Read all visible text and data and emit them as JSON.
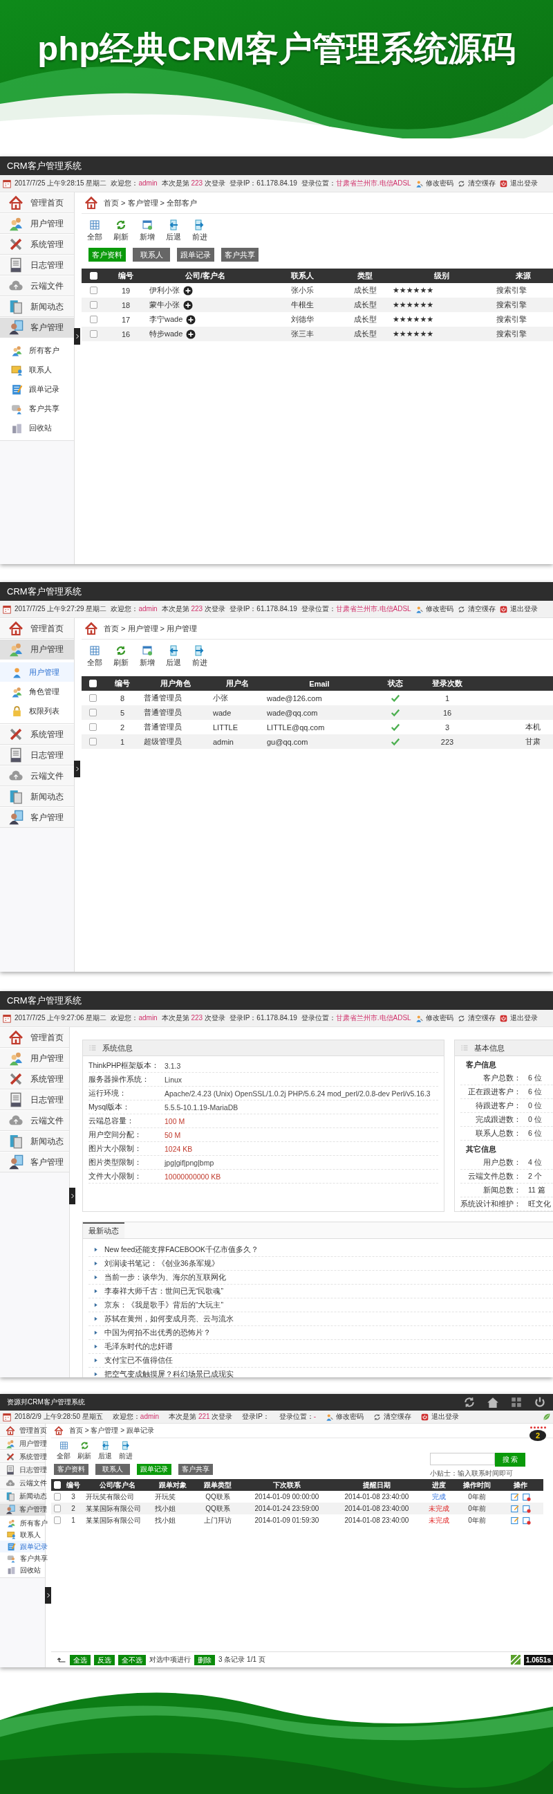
{
  "banner": {
    "title": "php经典CRM客户管理系统源码"
  },
  "screens": [
    {
      "kind": "list",
      "app_title": "CRM客户管理系统",
      "info": {
        "datetime": "2017/7/25 上午9:28:15 星期二",
        "welcome_label": "欢迎您：",
        "user": "admin",
        "login_prefix": "本次是第 ",
        "login_count": "223",
        "login_suffix": " 次登录",
        "ip": "登录IP：61.178.84.19",
        "location_label": "登录位置：",
        "location": "甘肃省兰州市.电信ADSL",
        "actions": [
          "修改密码",
          "清空缓存",
          "退出登录"
        ]
      },
      "sidebar": [
        {
          "label": "管理首页",
          "selected": false
        },
        {
          "label": "用户管理",
          "selected": false
        },
        {
          "label": "系统管理",
          "selected": false
        },
        {
          "label": "日志管理",
          "selected": false
        },
        {
          "label": "云端文件",
          "selected": false
        },
        {
          "label": "新闻动态",
          "selected": false
        },
        {
          "label": "客户管理",
          "selected": true,
          "children": [
            {
              "label": "所有客户",
              "selected": false
            },
            {
              "label": "联系人",
              "selected": false
            },
            {
              "label": "跟单记录",
              "selected": false
            },
            {
              "label": "客户共享",
              "selected": false
            },
            {
              "label": "回收站",
              "selected": false
            }
          ]
        }
      ],
      "breadcrumb": "首页 > 客户管理 > 全部客户",
      "toolbar": [
        "全部",
        "刷新",
        "新增",
        "后退",
        "前进"
      ],
      "tabs": [
        {
          "label": "客户资料",
          "selected": true
        },
        {
          "label": "联系人",
          "selected": false
        },
        {
          "label": "跟单记录",
          "selected": false
        },
        {
          "label": "客户共享",
          "selected": false
        }
      ],
      "table": {
        "select_all": {
          "checked": false
        },
        "columns": [
          {
            "kind": "text",
            "label": "编号"
          },
          {
            "kind": "name_plus",
            "label": "公司/客户名"
          },
          {
            "kind": "text",
            "label": "联系人"
          },
          {
            "kind": "text",
            "label": "类型"
          },
          {
            "kind": "text",
            "label": "级别"
          },
          {
            "kind": "text",
            "label": "来源"
          }
        ],
        "rows": [
          {
            "checked": false,
            "cells": [
              "19",
              "伊利小张",
              "张小乐",
              "成长型",
              "★★★★★★",
              "搜索引擎"
            ]
          },
          {
            "checked": false,
            "cells": [
              "18",
              "蒙牛小张",
              "牛根生",
              "成长型",
              "★★★★★★",
              "搜索引擎"
            ]
          },
          {
            "checked": false,
            "cells": [
              "17",
              "李宁wade",
              "刘德华",
              "成长型",
              "★★★★★★",
              "搜索引擎"
            ]
          },
          {
            "checked": false,
            "cells": [
              "16",
              "特步wade",
              "张三丰",
              "成长型",
              "★★★★★★",
              "搜索引擎"
            ]
          }
        ]
      }
    },
    {
      "kind": "list",
      "app_title": "CRM客户管理系统",
      "info": {
        "datetime": "2017/7/25 上午9:27:29 星期二",
        "welcome_label": "欢迎您：",
        "user": "admin",
        "login_prefix": "本次是第 ",
        "login_count": "223",
        "login_suffix": " 次登录",
        "ip": "登录IP：61.178.84.19",
        "location_label": "登录位置：",
        "location": "甘肃省兰州市.电信ADSL",
        "actions": [
          "修改密码",
          "清空缓存",
          "退出登录"
        ]
      },
      "sidebar": [
        {
          "label": "管理首页",
          "selected": false
        },
        {
          "label": "用户管理",
          "selected": true,
          "children": [
            {
              "label": "用户管理",
              "selected": true
            },
            {
              "label": "角色管理",
              "selected": false
            },
            {
              "label": "权限列表",
              "selected": false
            }
          ]
        },
        {
          "label": "系统管理",
          "selected": false
        },
        {
          "label": "日志管理",
          "selected": false
        },
        {
          "label": "云端文件",
          "selected": false
        },
        {
          "label": "新闻动态",
          "selected": false
        },
        {
          "label": "客户管理",
          "selected": false
        }
      ],
      "breadcrumb": "首页 > 用户管理 > 用户管理",
      "toolbar": [
        "全部",
        "刷新",
        "新增",
        "后退",
        "前进"
      ],
      "table": {
        "select_all": {
          "checked": false
        },
        "columns": [
          {
            "kind": "text",
            "label": "编号"
          },
          {
            "kind": "text",
            "label": "用户角色"
          },
          {
            "kind": "text",
            "label": "用户名"
          },
          {
            "kind": "text",
            "label": "Email"
          },
          {
            "kind": "status",
            "label": "状态"
          },
          {
            "kind": "text",
            "label": "登录次数"
          },
          {
            "kind": "text"
          }
        ],
        "rows": [
          {
            "checked": false,
            "cells": [
              "8",
              "普通管理员",
              "小张",
              "wade@126.com",
              true,
              "1",
              null
            ]
          },
          {
            "checked": false,
            "cells": [
              "5",
              "普通管理员",
              "wade",
              "wade@qq.com",
              true,
              "16",
              null
            ]
          },
          {
            "checked": false,
            "cells": [
              "2",
              "普通管理员",
              "LITTLE",
              "LITTLE@qq.com",
              true,
              "3",
              "本机"
            ]
          },
          {
            "checked": false,
            "cells": [
              "1",
              "超级管理员",
              "admin",
              "gu@qq.com",
              true,
              "223",
              "甘肃"
            ]
          }
        ]
      }
    },
    {
      "kind": "dashboard",
      "app_title": "CRM客户管理系统",
      "info": {
        "datetime": "2017/7/25 上午9:27:06 星期二",
        "welcome_label": "欢迎您：",
        "user": "admin",
        "login_prefix": "本次是第 ",
        "login_count": "223",
        "login_suffix": " 次登录",
        "ip": "登录IP：61.178.84.19",
        "location_label": "登录位置：",
        "location": "甘肃省兰州市.电信ADSL",
        "actions": [
          "修改密码",
          "清空缓存",
          "退出登录"
        ]
      },
      "sidebar": [
        {
          "label": "管理首页",
          "selected": false
        },
        {
          "label": "用户管理",
          "selected": false
        },
        {
          "label": "系统管理",
          "selected": false
        },
        {
          "label": "日志管理",
          "selected": false
        },
        {
          "label": "云端文件",
          "selected": false
        },
        {
          "label": "新闻动态",
          "selected": false
        },
        {
          "label": "客户管理",
          "selected": false
        }
      ],
      "system_info": {
        "title": "系统信息",
        "items": [
          {
            "label": "ThinkPHP框架版本：",
            "value": "3.1.3",
            "highlight": false
          },
          {
            "label": "服务器操作系统：",
            "value": "Linux",
            "highlight": false
          },
          {
            "label": "运行环境：",
            "value": "Apache/2.4.23 (Unix) OpenSSL/1.0.2j PHP/5.6.24 mod_perl/2.0.8-dev Perl/v5.16.3",
            "highlight": false
          },
          {
            "label": "Mysql版本：",
            "value": "5.5.5-10.1.19-MariaDB",
            "highlight": false
          },
          {
            "label": "云端总容量：",
            "value": "100 M",
            "highlight": true
          },
          {
            "label": "用户空间分配：",
            "value": "50 M",
            "highlight": true
          },
          {
            "label": "图片大小限制：",
            "value": "1024 KB",
            "highlight": true
          },
          {
            "label": "图片类型限制：",
            "value": "jpg|gif|png|bmp",
            "highlight": false
          },
          {
            "label": "文件大小限制：",
            "value": "10000000000 KB",
            "highlight": true
          }
        ]
      },
      "basic_info": {
        "title": "基本信息",
        "groups": [
          {
            "title": "客户信息",
            "items": [
              {
                "label": "客户总数：",
                "value": "6 位"
              },
              {
                "label": "正在跟进客户：",
                "value": "6 位"
              },
              {
                "label": "待跟进客户：",
                "value": "0 位"
              },
              {
                "label": "完成跟进数：",
                "value": "0 位"
              },
              {
                "label": "联系人总数：",
                "value": "6 位"
              }
            ]
          },
          {
            "title": "其它信息",
            "items": [
              {
                "label": "用户总数：",
                "value": "4 位"
              },
              {
                "label": "云端文件总数：",
                "value": "2 个"
              },
              {
                "label": "新闻总数：",
                "value": "11 篇"
              },
              {
                "label": "系统设计和维护：",
                "value": "旺文化"
              }
            ]
          }
        ]
      },
      "news": {
        "title": "最新动态",
        "items": [
          "New feed还能支撑FACEBOOK千亿市值多久？",
          "刘润读书笔记：《创业36条军规》",
          "当前一步：谈华为、海尔的互联网化",
          "李泰祥大师千古：世间已无“民歌魂”",
          "京东：《我是歌手》背后的“大玩主”",
          "苏轼在黄州，如何变成月亮、云与流水",
          "中国为何拍不出优秀的恐怖片？",
          "毛泽东时代的忠奸谱",
          "支付宝已不值得信任",
          "把空气变成触摸屏？科幻场景已成现实"
        ]
      }
    },
    {
      "kind": "compact_list",
      "app_title": "资源邦CRM客户管理系统",
      "info": {
        "datetime": "2018/2/9 上午9:28:50 星期五",
        "welcome_label": "欢迎您：",
        "user": "admin",
        "login_prefix": "本次是第 ",
        "login_count": "221",
        "login_suffix": " 次登录",
        "ip": "登录IP：",
        "location_label": "登录位置：",
        "location": "-",
        "actions": [
          "修改密码",
          "清空缓存",
          "退出登录"
        ]
      },
      "sidebar": [
        {
          "label": "管理首页",
          "selected": false
        },
        {
          "label": "用户管理",
          "selected": false
        },
        {
          "label": "系统管理",
          "selected": false
        },
        {
          "label": "日志管理",
          "selected": false
        },
        {
          "label": "云端文件",
          "selected": false
        },
        {
          "label": "新闻动态",
          "selected": false
        },
        {
          "label": "客户管理",
          "selected": true,
          "children": [
            {
              "label": "所有客户",
              "selected": false
            },
            {
              "label": "联系人",
              "selected": false
            },
            {
              "label": "跟单记录",
              "selected": true
            },
            {
              "label": "客户共享",
              "selected": false
            },
            {
              "label": "回收站",
              "selected": false
            }
          ]
        }
      ],
      "breadcrumb": "首页 > 客户管理 > 跟单记录",
      "notice_count": "2",
      "toolbar": [
        "全部",
        "刷新",
        "后退",
        "前进"
      ],
      "tabs": [
        {
          "label": "客户资料",
          "selected": false
        },
        {
          "label": "联系人",
          "selected": false
        },
        {
          "label": "跟单记录",
          "selected": true
        },
        {
          "label": "客户共享",
          "selected": false
        }
      ],
      "search": {
        "button": "搜 索",
        "tip": "小贴士：输入联系时间即可"
      },
      "table": {
        "select_all": {
          "checked": false
        },
        "columns": [
          {
            "kind": "text",
            "label": "编号"
          },
          {
            "kind": "text",
            "label": "公司/客户名"
          },
          {
            "kind": "text",
            "label": "跟单对象"
          },
          {
            "kind": "text",
            "label": "跟单类型"
          },
          {
            "kind": "text",
            "label": "下次联系"
          },
          {
            "kind": "text",
            "label": "提醒日期"
          },
          {
            "kind": "progress",
            "label": "进度"
          },
          {
            "kind": "text",
            "label": "操作时间"
          },
          {
            "kind": "actions",
            "label": "操作"
          }
        ],
        "rows": [
          {
            "checked": false,
            "cells": [
              "3",
              "开玩笑有限公司",
              "开玩笑",
              "QQ联系",
              "2014-01-09 00:00:00",
              "2014-01-08 23:40:00",
              {
                "text": "完成",
                "done": true
              },
              "0年前",
              null
            ]
          },
          {
            "checked": false,
            "cells": [
              "2",
              "某某国际有限公司",
              "找小姐",
              "QQ联系",
              "2014-01-24 23:59:00",
              "2014-01-08 23:40:00",
              {
                "text": "未完成",
                "done": false
              },
              "0年前",
              null
            ]
          },
          {
            "checked": false,
            "cells": [
              "1",
              "某某国际有限公司",
              "找小姐",
              "上门拜访",
              "2014-01-09 01:59:30",
              "2014-01-08 23:40:00",
              {
                "text": "未完成",
                "done": false
              },
              "0年前",
              null
            ]
          }
        ]
      },
      "footer": {
        "buttons": [
          "全选",
          "反选",
          "全不选"
        ],
        "action_label": "对选中项进行",
        "action_button": "删除",
        "summary": "3 条记录 1/1 页",
        "timer": "1.0651s"
      }
    }
  ]
}
